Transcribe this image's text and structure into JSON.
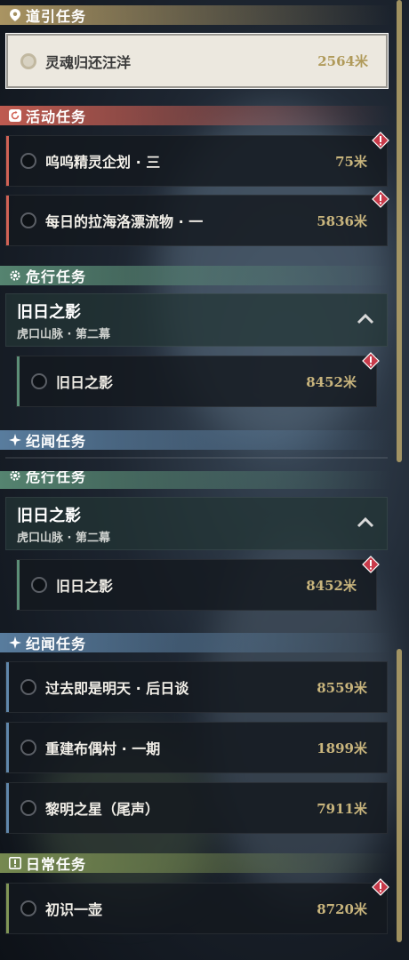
{
  "colors": {
    "gold": "#c4aa6e",
    "red": "#d16255",
    "green": "#5c8f78",
    "blue": "#6087ab",
    "olive": "#819656",
    "distance": "#c9b57d",
    "alert": "#c83a4a"
  },
  "top": {
    "guide_header": {
      "icon": "location-pin-icon",
      "label": "道引任务"
    },
    "guide_task": {
      "name": "灵魂归还汪洋",
      "distance": "2564米"
    },
    "activity_header": {
      "icon": "refresh-icon",
      "label": "活动任务"
    },
    "activity_tasks": [
      {
        "name": "呜呜精灵企划 · 三",
        "distance": "75米"
      },
      {
        "name": "每日的拉海洛漂流物 · 一",
        "distance": "5836米"
      }
    ],
    "danger_header": {
      "icon": "gear-icon",
      "label": "危行任务"
    },
    "danger_group": {
      "title": "旧日之影",
      "subtitle": "虎口山脉 · 第二幕"
    },
    "danger_task": {
      "name": "旧日之影",
      "distance": "8452米"
    },
    "chronicle_header": {
      "icon": "sparkle-icon",
      "label": "纪闻任务"
    }
  },
  "bottom": {
    "danger_header": {
      "label": "危行任务"
    },
    "danger_group": {
      "title": "旧日之影",
      "subtitle": "虎口山脉 · 第二幕"
    },
    "danger_task": {
      "name": "旧日之影",
      "distance": "8452米"
    },
    "chronicle_header": {
      "icon": "sparkle-icon",
      "label": "纪闻任务"
    },
    "chronicle_tasks": [
      {
        "name": "过去即是明天 · 后日谈",
        "distance": "8559米"
      },
      {
        "name": "重建布偶村 · 一期",
        "distance": "1899米"
      },
      {
        "name": "黎明之星（尾声）",
        "distance": "7911米"
      }
    ],
    "daily_header": {
      "icon": "exclamation-box-icon",
      "label": "日常任务"
    },
    "daily_task": {
      "name": "初识一壶",
      "distance": "8720米"
    }
  }
}
